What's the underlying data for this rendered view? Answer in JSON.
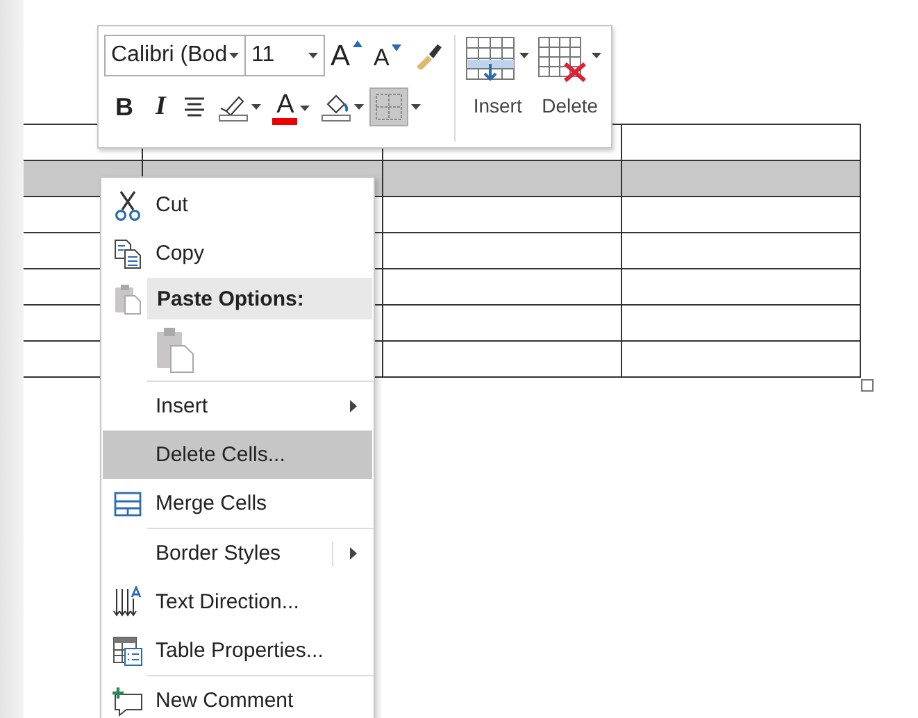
{
  "table": {
    "rows": [
      {
        "selected": false
      },
      {
        "selected": true
      },
      {
        "selected": false
      },
      {
        "selected": false
      },
      {
        "selected": false
      },
      {
        "selected": false
      },
      {
        "selected": false
      }
    ]
  },
  "toolbar": {
    "font": {
      "value": "Calibri (Bod"
    },
    "size": {
      "value": "11"
    },
    "row1": [
      {
        "kind": "grow",
        "label": "A"
      },
      {
        "kind": "shrink",
        "label": "A"
      },
      {
        "kind": "painter"
      }
    ],
    "row2": [
      {
        "kind": "bold",
        "label": "B",
        "on": false
      },
      {
        "kind": "italic",
        "label": "I",
        "on": false
      },
      {
        "kind": "center",
        "on": false
      },
      {
        "kind": "highlight",
        "on": false
      },
      {
        "kind": "fontcolor",
        "label": "A",
        "on": false
      },
      {
        "kind": "shading",
        "on": false
      },
      {
        "kind": "borders",
        "on": true
      }
    ],
    "big": [
      {
        "kind": "insert",
        "label": "Insert"
      },
      {
        "kind": "delete",
        "label": "Delete"
      }
    ]
  },
  "menu": {
    "items": [
      {
        "kind": "item",
        "label": "Cut",
        "selected": false
      },
      {
        "kind": "item",
        "label": "Copy",
        "selected": false
      },
      {
        "kind": "header",
        "label": "Paste Options:"
      },
      {
        "kind": "paste"
      },
      {
        "kind": "item",
        "label": "Insert",
        "submenu": true,
        "separator_before": true,
        "selected": false
      },
      {
        "kind": "item",
        "label": "Delete Cells...",
        "selected": true
      },
      {
        "kind": "item",
        "label": "Merge Cells",
        "selected": false
      },
      {
        "kind": "item",
        "label": "Border Styles",
        "submenu": true,
        "split": true,
        "separator_before": true,
        "selected": false
      },
      {
        "kind": "item",
        "label": "Text Direction...",
        "selected": false
      },
      {
        "kind": "item",
        "label": "Table Properties...",
        "selected": false
      },
      {
        "kind": "item",
        "label": "New Comment",
        "separator_before": true,
        "selected": false
      }
    ]
  }
}
